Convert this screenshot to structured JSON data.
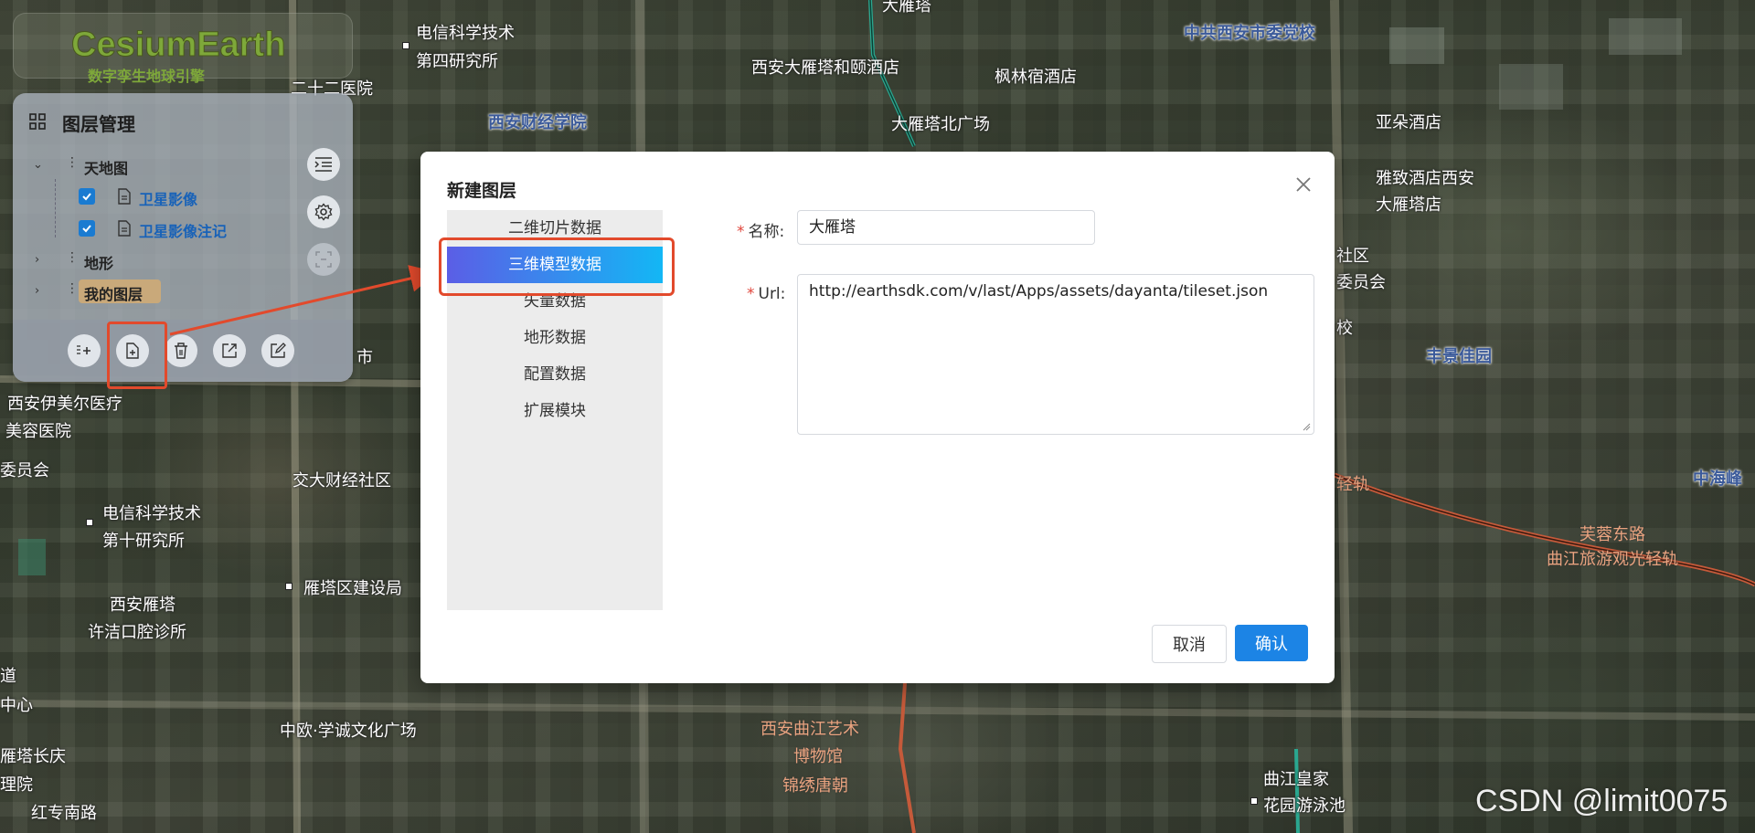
{
  "logo": {
    "title": "CesiumEarth",
    "subtitle": "数字孪生地球引擎"
  },
  "layer_panel": {
    "title": "图层管理",
    "tree": [
      {
        "label": "天地图",
        "expanded": true,
        "children": [
          {
            "label": "卫星影像",
            "checked": true
          },
          {
            "label": "卫星影像注记",
            "checked": true
          }
        ]
      },
      {
        "label": "地形",
        "expanded": false
      },
      {
        "label": "我的图层",
        "expanded": false
      }
    ],
    "side_buttons": [
      "list-indent-icon",
      "gear-icon",
      "frame-icon"
    ],
    "footer_buttons": [
      "add-folder-icon",
      "new-layer-icon",
      "trash-icon",
      "export-icon",
      "edit-icon"
    ]
  },
  "map_labels": [
    {
      "text": "大雁塔",
      "style": "normal"
    },
    {
      "text": "电信科学技术",
      "style": "normal"
    },
    {
      "text": "第四研究所",
      "style": "normal"
    },
    {
      "text": "二十二医院",
      "style": "normal"
    },
    {
      "text": "西安大雁塔和颐酒店",
      "style": "normal"
    },
    {
      "text": "枫林宿酒店",
      "style": "normal"
    },
    {
      "text": "中共西安市委党校",
      "style": "blue"
    },
    {
      "text": "西安财经学院",
      "style": "blue"
    },
    {
      "text": "大雁塔北广场",
      "style": "normal"
    },
    {
      "text": "亚朵酒店",
      "style": "normal"
    },
    {
      "text": "雅致酒店西安",
      "style": "normal"
    },
    {
      "text": "大雁塔店",
      "style": "normal"
    },
    {
      "text": "社区",
      "style": "normal"
    },
    {
      "text": "委员会",
      "style": "normal"
    },
    {
      "text": "校",
      "style": "normal"
    },
    {
      "text": "丰景佳园",
      "style": "blue"
    },
    {
      "text": "市",
      "style": "normal"
    },
    {
      "text": "西安伊美尔医疗",
      "style": "normal"
    },
    {
      "text": "美容医院",
      "style": "normal"
    },
    {
      "text": "委员会",
      "style": "normal"
    },
    {
      "text": "交大财经社区",
      "style": "normal"
    },
    {
      "text": "电信科学技术",
      "style": "normal"
    },
    {
      "text": "第十研究所",
      "style": "normal"
    },
    {
      "text": "雁塔区建设局",
      "style": "normal"
    },
    {
      "text": "西安雁塔",
      "style": "normal"
    },
    {
      "text": "许洁口腔诊所",
      "style": "normal"
    },
    {
      "text": "道",
      "style": "normal"
    },
    {
      "text": "中心",
      "style": "normal"
    },
    {
      "text": "中欧·学诚文化广场",
      "style": "normal"
    },
    {
      "text": "西安曲江艺术",
      "style": "rail"
    },
    {
      "text": "博物馆",
      "style": "rail"
    },
    {
      "text": "锦绣唐朝",
      "style": "rail"
    },
    {
      "text": "雁塔长庆",
      "style": "normal"
    },
    {
      "text": "理院",
      "style": "normal"
    },
    {
      "text": "红专南路",
      "style": "normal"
    },
    {
      "text": "曲江皇家",
      "style": "normal"
    },
    {
      "text": "花园游泳池",
      "style": "normal"
    },
    {
      "text": "芙蓉东路",
      "style": "rail"
    },
    {
      "text": "曲江旅游观光轻轨",
      "style": "rail"
    },
    {
      "text": "中海峰",
      "style": "blue"
    },
    {
      "text": "轻轨",
      "style": "rail"
    }
  ],
  "dialog": {
    "title": "新建图层",
    "menu_items": [
      "二维切片数据",
      "三维模型数据",
      "矢量数据",
      "地形数据",
      "配置数据",
      "扩展模块"
    ],
    "active_menu_index": 1,
    "form": {
      "name_label": "名称:",
      "name_value": "大雁塔",
      "url_label": "Url:",
      "url_value": "http://earthsdk.com/v/last/Apps/assets/dayanta/tileset.json"
    },
    "cancel_label": "取消",
    "confirm_label": "确认"
  },
  "watermark": "CSDN @limit0075",
  "colors": {
    "accent": "#1c84e5",
    "highlight": "#e24a2c",
    "menu_gradient_start": "#5b5ee6",
    "menu_gradient_end": "#13b7f5",
    "required": "#e0443a"
  }
}
